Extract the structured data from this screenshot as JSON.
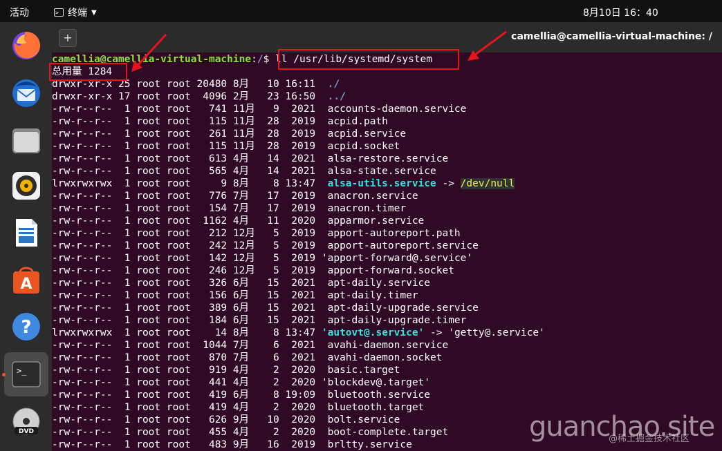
{
  "topbar": {
    "activities": "活动",
    "app_name": "终端",
    "clock": "8月10日  16：40"
  },
  "dock": {
    "items": [
      {
        "name": "firefox-icon"
      },
      {
        "name": "thunderbird-icon"
      },
      {
        "name": "files-icon"
      },
      {
        "name": "rhythmbox-icon"
      },
      {
        "name": "libreoffice-writer-icon"
      },
      {
        "name": "software-center-icon"
      },
      {
        "name": "help-icon"
      },
      {
        "name": "terminal-icon"
      },
      {
        "name": "dvd-icon"
      }
    ]
  },
  "window": {
    "new_tab": "+",
    "title": "camellia@camellia-virtual-machine: /"
  },
  "terminal": {
    "prompt_user": "camellia@camellia-virtual-machine",
    "prompt_sep": ":",
    "prompt_path": "/",
    "prompt_dollar": "$ ",
    "command": "ll /usr/lib/systemd/system",
    "total": "总用量 1284",
    "rows": [
      {
        "meta": "drwxr-xr-x 25 root root 20480 8月   10 16:11  ",
        "name": "./",
        "kind": "dir"
      },
      {
        "meta": "drwxr-xr-x 17 root root  4096 2月   23 16:50  ",
        "name": "../",
        "kind": "dir"
      },
      {
        "meta": "-rw-r--r--  1 root root   741 11月   9  2021  ",
        "name": "accounts-daemon.service",
        "kind": "file"
      },
      {
        "meta": "-rw-r--r--  1 root root   115 11月  28  2019  ",
        "name": "acpid.path",
        "kind": "file"
      },
      {
        "meta": "-rw-r--r--  1 root root   261 11月  28  2019  ",
        "name": "acpid.service",
        "kind": "file"
      },
      {
        "meta": "-rw-r--r--  1 root root   115 11月  28  2019  ",
        "name": "acpid.socket",
        "kind": "file"
      },
      {
        "meta": "-rw-r--r--  1 root root   613 4月   14  2021  ",
        "name": "alsa-restore.service",
        "kind": "file"
      },
      {
        "meta": "-rw-r--r--  1 root root   565 4月   14  2021  ",
        "name": "alsa-state.service",
        "kind": "file"
      },
      {
        "meta": "lrwxrwxrwx  1 root root     9 8月    8 13:47  ",
        "name": "alsa-utils.service",
        "kind": "link-null",
        "arrow": " -> ",
        "target": "/dev/null"
      },
      {
        "meta": "-rw-r--r--  1 root root   776 7月   17  2019  ",
        "name": "anacron.service",
        "kind": "file"
      },
      {
        "meta": "-rw-r--r--  1 root root   154 7月   17  2019  ",
        "name": "anacron.timer",
        "kind": "file"
      },
      {
        "meta": "-rw-r--r--  1 root root  1162 4月   11  2020  ",
        "name": "apparmor.service",
        "kind": "file"
      },
      {
        "meta": "-rw-r--r--  1 root root   212 12月   5  2019  ",
        "name": "apport-autoreport.path",
        "kind": "file"
      },
      {
        "meta": "-rw-r--r--  1 root root   242 12月   5  2019  ",
        "name": "apport-autoreport.service",
        "kind": "file"
      },
      {
        "meta": "-rw-r--r--  1 root root   142 12月   5  2019 ",
        "name": "'apport-forward@.service'",
        "kind": "file"
      },
      {
        "meta": "-rw-r--r--  1 root root   246 12月   5  2019  ",
        "name": "apport-forward.socket",
        "kind": "file"
      },
      {
        "meta": "-rw-r--r--  1 root root   326 6月   15  2021  ",
        "name": "apt-daily.service",
        "kind": "file"
      },
      {
        "meta": "-rw-r--r--  1 root root   156 6月   15  2021  ",
        "name": "apt-daily.timer",
        "kind": "file"
      },
      {
        "meta": "-rw-r--r--  1 root root   389 6月   15  2021  ",
        "name": "apt-daily-upgrade.service",
        "kind": "file"
      },
      {
        "meta": "-rw-r--r--  1 root root   184 6月   15  2021  ",
        "name": "apt-daily-upgrade.timer",
        "kind": "file"
      },
      {
        "meta": "lrwxrwxrwx  1 root root    14 8月    8 13:47 ",
        "name": "'autovt@.service'",
        "kind": "link",
        "arrow": " -> ",
        "target": "'getty@.service'"
      },
      {
        "meta": "-rw-r--r--  1 root root  1044 7月    6  2021  ",
        "name": "avahi-daemon.service",
        "kind": "file"
      },
      {
        "meta": "-rw-r--r--  1 root root   870 7月    6  2021  ",
        "name": "avahi-daemon.socket",
        "kind": "file"
      },
      {
        "meta": "-rw-r--r--  1 root root   919 4月    2  2020  ",
        "name": "basic.target",
        "kind": "file"
      },
      {
        "meta": "-rw-r--r--  1 root root   441 4月    2  2020 ",
        "name": "'blockdev@.target'",
        "kind": "file"
      },
      {
        "meta": "-rw-r--r--  1 root root   419 6月    8 19:09  ",
        "name": "bluetooth.service",
        "kind": "file"
      },
      {
        "meta": "-rw-r--r--  1 root root   419 4月    2  2020  ",
        "name": "bluetooth.target",
        "kind": "file"
      },
      {
        "meta": "-rw-r--r--  1 root root   626 9月   10  2020  ",
        "name": "bolt.service",
        "kind": "file"
      },
      {
        "meta": "-rw-r--r--  1 root root   455 4月    2  2020  ",
        "name": "boot-complete.target",
        "kind": "file"
      },
      {
        "meta": "-rw-r--r--  1 root root   483 9月   16  2019  ",
        "name": "brltty.service",
        "kind": "file"
      }
    ]
  },
  "watermark": {
    "main": "guanchao.site",
    "sub": "@稀土掘金技术社区"
  },
  "colors": {
    "terminal_bg": "#300a24",
    "prompt_user": "#8ae234",
    "prompt_path": "#729fcf",
    "link": "#34e2e2",
    "highlight": "#e8141c"
  }
}
